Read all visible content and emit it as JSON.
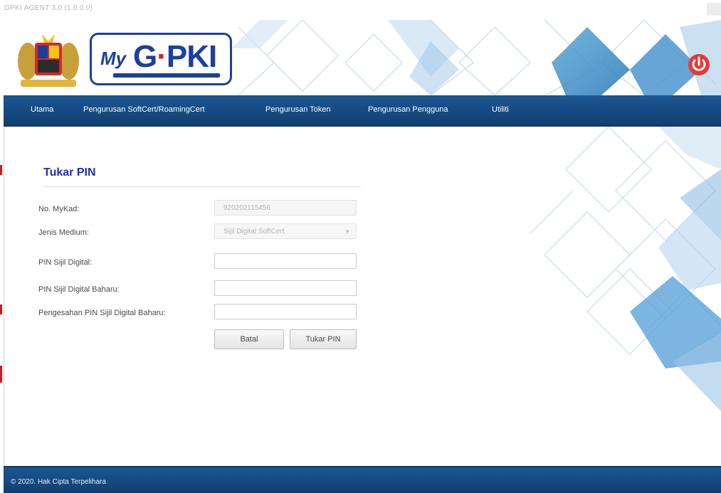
{
  "window": {
    "title": "GPKI AGENT 3.0 (1.0.0.0)"
  },
  "header": {
    "logo_prefix": "My",
    "logo_g": "G",
    "logo_rest": "PKI"
  },
  "nav": {
    "items": [
      {
        "label": "Utama"
      },
      {
        "label": "Pengurusan SoftCert/RoamingCert"
      },
      {
        "label": "Pengurusan Token"
      },
      {
        "label": "Pengurusan Pengguna"
      },
      {
        "label": "Utiliti"
      }
    ]
  },
  "form": {
    "title": "Tukar PIN",
    "mykad_label": "No. MyKad:",
    "mykad_value": "920202115456",
    "medium_label": "Jenis Medium:",
    "medium_value": "Sijil Digital SoftCert",
    "pin_label": "PIN Sijil Digital:",
    "new_pin_label": "PIN Sijil Digital Baharu:",
    "confirm_pin_label": "Pengesahan PIN Sijil Digital Baharu:",
    "cancel_label": "Batal",
    "submit_label": "Tukar PIN"
  },
  "footer": {
    "copyright": "© 2020. Hak Cipta Terpelihara"
  },
  "colors": {
    "brand_blue": "#1a5794",
    "title_blue": "#1f2fb8",
    "power_red": "#e53935"
  },
  "icons": {
    "power": "power-icon",
    "dropdown": "chevron-down-icon"
  }
}
